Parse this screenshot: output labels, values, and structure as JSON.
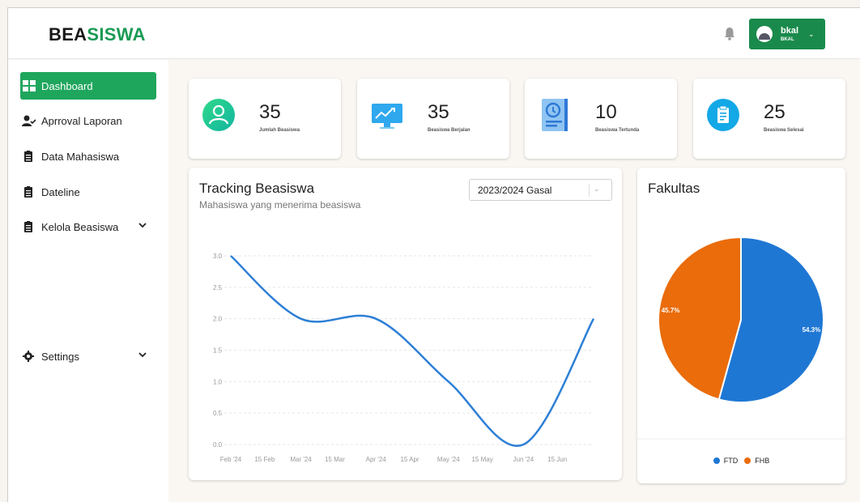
{
  "header": {
    "brand_part1": "BEA",
    "brand_part2": "SISWA",
    "user_name": "bkal",
    "user_role": "BKAL"
  },
  "sidebar": {
    "items": [
      {
        "label": "Dashboard"
      },
      {
        "label": "Aprroval Laporan"
      },
      {
        "label": "Data Mahasiswa"
      },
      {
        "label": "Dateline"
      },
      {
        "label": "Kelola Beasiswa"
      },
      {
        "label": "Settings"
      }
    ]
  },
  "stats": [
    {
      "value": "35",
      "label": "Jumlah Beasiswa"
    },
    {
      "value": "35",
      "label": "Beasiswa Berjalan"
    },
    {
      "value": "10",
      "label": "Beasiswa Tertunda"
    },
    {
      "value": "25",
      "label": "Beasiswa Selesai"
    }
  ],
  "tracking": {
    "title": "Tracking Beasiswa",
    "subtitle": "Mahasiswa yang menerima beasiswa",
    "selected_period": "2023/2024 Gasal"
  },
  "fakultas": {
    "title": "Fakultas"
  },
  "chart_data": [
    {
      "type": "line",
      "title": "Tracking Beasiswa",
      "subtitle": "Mahasiswa yang menerima beasiswa",
      "x": [
        "2024-02-01",
        "2024-02-15",
        "2024-03-01",
        "2024-03-15",
        "2024-04-01",
        "2024-04-15",
        "2024-05-01",
        "2024-05-15",
        "2024-06-01",
        "2024-06-15"
      ],
      "x_tick_labels": [
        "Feb '24",
        "15 Feb",
        "Mar '24",
        "15 Mar",
        "Apr '24",
        "15 Apr",
        "May '24",
        "15 May",
        "Jun '24",
        "15 Jun"
      ],
      "series": [
        {
          "x": [
            "2024-02-01",
            "2024-03-01",
            "2024-04-01",
            "2024-05-01",
            "2024-06-01",
            "2024-06-30"
          ],
          "values": [
            3,
            2,
            2,
            1,
            0,
            2
          ]
        }
      ],
      "y_ticks": [
        "0.0",
        "0.5",
        "1.0",
        "1.5",
        "2.0",
        "2.5",
        "3.0"
      ],
      "ylim": [
        0,
        3
      ],
      "grid": true,
      "color": "#2d7fd6"
    },
    {
      "type": "pie",
      "title": "Fakultas",
      "categories": [
        "FTD",
        "FHB"
      ],
      "values": [
        54.3,
        45.7
      ],
      "labels": [
        "54.3%",
        "45.7%"
      ],
      "colors": [
        "#1f77d4",
        "#ea6c0b"
      ],
      "legend": "bottom"
    }
  ],
  "colors": {
    "brand_green": "#1a9a55",
    "active_green": "#1fa65d",
    "user_btn": "#1a8a4c"
  }
}
